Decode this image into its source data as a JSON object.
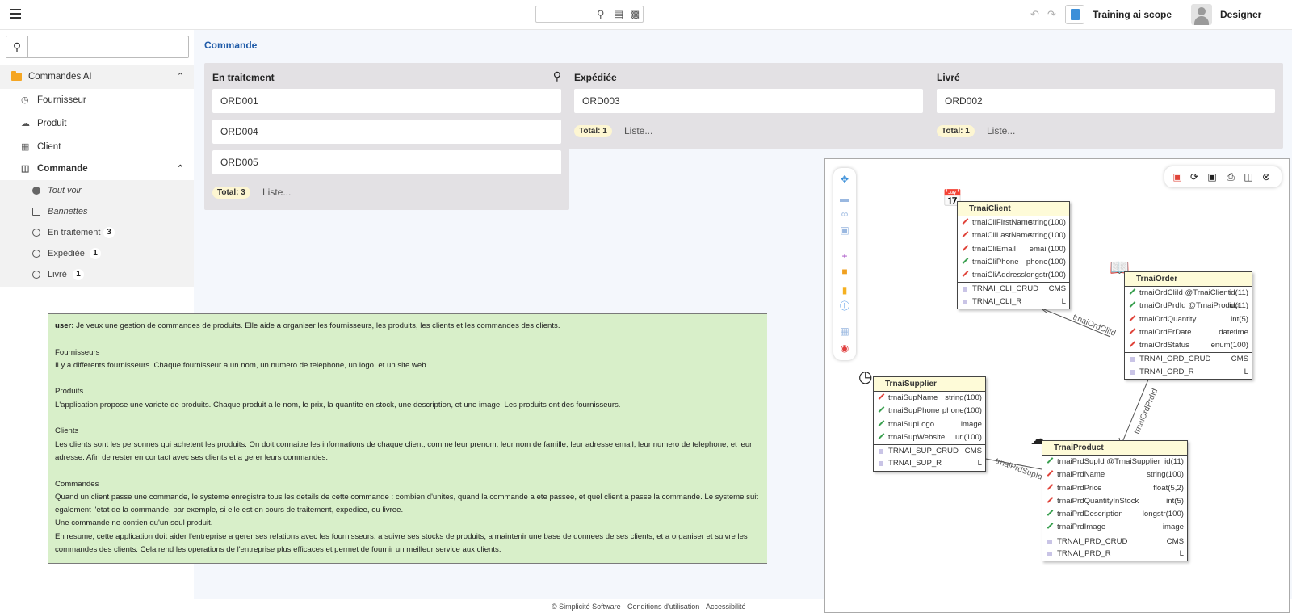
{
  "topbar": {
    "project": "Training ai scope",
    "user": "Designer"
  },
  "sidebar": {
    "root": "Commandes AI",
    "items": [
      {
        "label": "Fournisseur"
      },
      {
        "label": "Produit"
      },
      {
        "label": "Client"
      },
      {
        "label": "Commande"
      }
    ],
    "sub": [
      {
        "label": "Tout voir"
      },
      {
        "label": "Bannettes"
      },
      {
        "label": "En traitement",
        "count": "3"
      },
      {
        "label": "Expédiée",
        "count": "1"
      },
      {
        "label": "Livré",
        "count": "1"
      }
    ]
  },
  "main": {
    "breadcrumb": "Commande",
    "columns": [
      {
        "title": "En traitement",
        "cards": [
          "ORD001",
          "ORD004",
          "ORD005"
        ],
        "total": "Total: 3",
        "liste": "Liste..."
      },
      {
        "title": "Expédiée",
        "cards": [
          "ORD003"
        ],
        "total": "Total: 1",
        "liste": "Liste..."
      },
      {
        "title": "Livré",
        "cards": [
          "ORD002"
        ],
        "total": "Total: 1",
        "liste": "Liste..."
      }
    ]
  },
  "prompt": {
    "user_label": "user:",
    "p0": " Je veux une gestion de commandes de produits. Elle aide a organiser les fournisseurs, les produits, les clients et les commandes des clients.",
    "h1": "Fournisseurs",
    "p1": "Il y a differents fournisseurs. Chaque fournisseur a un nom, un numero de telephone, un logo, et un site web.",
    "h2": "Produits",
    "p2": "L'application propose une variete de produits. Chaque produit a le nom, le prix, la quantite en stock, une description, et une image. Les produits ont des fournisseurs.",
    "h3": "Clients",
    "p3": "Les clients sont les personnes qui achetent les produits. On doit connaitre les informations de chaque client, comme leur prenom, leur nom de famille, leur adresse email, leur numero de telephone, et leur adresse. Afin de rester en contact avec ses clients et a gerer leurs commandes.",
    "h4": "Commandes",
    "p4": "Quand un client passe une commande, le systeme enregistre tous les details de cette commande : combien d'unites, quand la commande a ete passee, et quel client a passe la commande. Le systeme suit egalement l'etat de la commande, par exemple, si elle est en cours de traitement, expediee, ou livree.",
    "p5": "Une commande ne contien qu'un seul produit.",
    "p6": "En resume, cette application doit aider l'entreprise a gerer ses relations avec les fournisseurs, a suivre ses stocks de produits, a maintenir une base de donnees de ses clients, et a organiser et suivre les commandes des clients. Cela rend les operations de l'entreprise plus efficaces et permet de fournir un meilleur service aux clients."
  },
  "footer": {
    "copyright": "© Simplicité Software",
    "terms": "Conditions d'utilisation",
    "access": "Accessibilité"
  },
  "diagram": {
    "client": {
      "name": "TrnaiClient",
      "fields": [
        {
          "n": "trnaiCliFirstName",
          "t": "string(100)",
          "c": "#e0443a"
        },
        {
          "n": "trnaiCliLastName",
          "t": "string(100)",
          "c": "#e0443a"
        },
        {
          "n": "trnaiCliEmail",
          "t": "email(100)",
          "c": "#e0443a"
        },
        {
          "n": "trnaiCliPhone",
          "t": "phone(100)",
          "c": "#3aa050"
        },
        {
          "n": "trnaiCliAddress",
          "t": "longstr(100)",
          "c": "#e0443a"
        }
      ],
      "acts": [
        {
          "n": "TRNAI_CLI_CRUD",
          "t": "CMS"
        },
        {
          "n": "TRNAI_CLI_R",
          "t": "L"
        }
      ]
    },
    "order": {
      "name": "TrnaiOrder",
      "fields": [
        {
          "n": "trnaiOrdCliId @TrnaiClient",
          "t": "id(11)",
          "c": "#3aa050"
        },
        {
          "n": "trnaiOrdPrdId @TrnaiProduct",
          "t": "id(11)",
          "c": "#3aa050"
        },
        {
          "n": "trnaiOrdQuantity",
          "t": "int(5)",
          "c": "#e0443a"
        },
        {
          "n": "trnaiOrdErDate",
          "t": "datetime",
          "c": "#e0443a"
        },
        {
          "n": "trnaiOrdStatus",
          "t": "enum(100)",
          "c": "#e0443a"
        }
      ],
      "acts": [
        {
          "n": "TRNAI_ORD_CRUD",
          "t": "CMS"
        },
        {
          "n": "TRNAI_ORD_R",
          "t": "L"
        }
      ]
    },
    "supplier": {
      "name": "TrnaiSupplier",
      "fields": [
        {
          "n": "trnaiSupName",
          "t": "string(100)",
          "c": "#e0443a"
        },
        {
          "n": "trnaiSupPhone",
          "t": "phone(100)",
          "c": "#3aa050"
        },
        {
          "n": "trnaiSupLogo",
          "t": "image",
          "c": "#3aa050"
        },
        {
          "n": "trnaiSupWebsite",
          "t": "url(100)",
          "c": "#3aa050"
        }
      ],
      "acts": [
        {
          "n": "TRNAI_SUP_CRUD",
          "t": "CMS"
        },
        {
          "n": "TRNAI_SUP_R",
          "t": "L"
        }
      ]
    },
    "product": {
      "name": "TrnaiProduct",
      "fields": [
        {
          "n": "trnaiPrdSupId @TrnaiSupplier",
          "t": "id(11)",
          "c": "#3aa050"
        },
        {
          "n": "trnaiPrdName",
          "t": "string(100)",
          "c": "#e0443a"
        },
        {
          "n": "trnaiPrdPrice",
          "t": "float(5,2)",
          "c": "#e0443a"
        },
        {
          "n": "trnaiPrdQuantityInStock",
          "t": "int(5)",
          "c": "#e0443a"
        },
        {
          "n": "trnaiPrdDescription",
          "t": "longstr(100)",
          "c": "#3aa050"
        },
        {
          "n": "trnaiPrdImage",
          "t": "image",
          "c": "#3aa050"
        }
      ],
      "acts": [
        {
          "n": "TRNAI_PRD_CRUD",
          "t": "CMS"
        },
        {
          "n": "TRNAI_PRD_R",
          "t": "L"
        }
      ]
    },
    "links": {
      "cli": "trnaiOrdCliId",
      "prd": "trnaiOrdPrdId",
      "sup": "trnaiPrdSupId"
    }
  }
}
